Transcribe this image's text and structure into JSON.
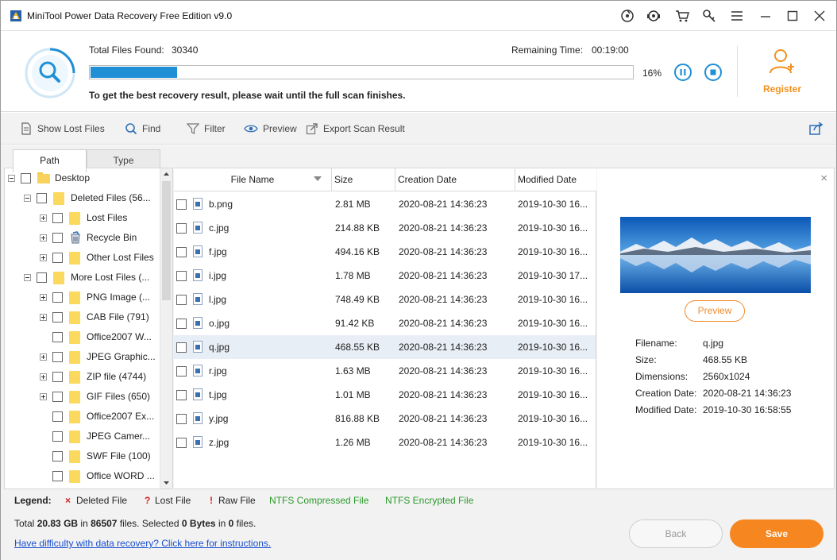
{
  "window": {
    "title": "MiniTool Power Data Recovery Free Edition v9.0"
  },
  "scan": {
    "total_label": "Total Files Found:",
    "total_value": "30340",
    "remaining_label": "Remaining Time:",
    "remaining_value": "00:19:00",
    "progress_text": "16%",
    "progress_fraction": 0.16,
    "hint": "To get the best recovery result, please wait until the full scan finishes.",
    "register_label": "Register"
  },
  "toolbar": {
    "show_lost": "Show Lost Files",
    "find": "Find",
    "filter": "Filter",
    "preview": "Preview",
    "export": "Export Scan Result"
  },
  "tabs": {
    "path": "Path",
    "type": "Type"
  },
  "tree": [
    {
      "label": "Desktop",
      "level": 0,
      "expander": "minus",
      "icon": "folder"
    },
    {
      "label": "Deleted Files (56...",
      "level": 1,
      "expander": "minus",
      "icon": "folder-tall"
    },
    {
      "label": "Lost Files",
      "level": 2,
      "expander": "plus",
      "icon": "folder-tall"
    },
    {
      "label": "Recycle Bin",
      "level": 2,
      "expander": "plus",
      "icon": "recycle-bin"
    },
    {
      "label": "Other Lost Files",
      "level": 2,
      "expander": "plus",
      "icon": "folder-tall"
    },
    {
      "label": "More Lost Files (...",
      "level": 1,
      "expander": "minus",
      "icon": "folder-tall"
    },
    {
      "label": "PNG Image (...",
      "level": 2,
      "expander": "plus",
      "icon": "folder-tall"
    },
    {
      "label": "CAB File (791)",
      "level": 2,
      "expander": "plus",
      "icon": "folder-tall"
    },
    {
      "label": "Office2007 W...",
      "level": 2,
      "expander": "none",
      "icon": "folder-tall"
    },
    {
      "label": "JPEG Graphic...",
      "level": 2,
      "expander": "plus",
      "icon": "folder-tall"
    },
    {
      "label": "ZIP file (4744)",
      "level": 2,
      "expander": "plus",
      "icon": "folder-tall"
    },
    {
      "label": "GIF Files (650)",
      "level": 2,
      "expander": "plus",
      "icon": "folder-tall"
    },
    {
      "label": "Office2007 Ex...",
      "level": 2,
      "expander": "none",
      "icon": "folder-tall"
    },
    {
      "label": "JPEG Camer...",
      "level": 2,
      "expander": "none",
      "icon": "folder-tall"
    },
    {
      "label": "SWF File (100)",
      "level": 2,
      "expander": "none",
      "icon": "folder-tall"
    },
    {
      "label": "Office WORD ...",
      "level": 2,
      "expander": "none",
      "icon": "folder-tall"
    }
  ],
  "table": {
    "columns": [
      "File Name",
      "Size",
      "Creation Date",
      "Modified Date"
    ],
    "rows": [
      {
        "name": "b.png",
        "size": "2.81 MB",
        "created": "2020-08-21 14:36:23",
        "modified": "2019-10-30 16..."
      },
      {
        "name": "c.jpg",
        "size": "214.88 KB",
        "created": "2020-08-21 14:36:23",
        "modified": "2019-10-30 16..."
      },
      {
        "name": "f.jpg",
        "size": "494.16 KB",
        "created": "2020-08-21 14:36:23",
        "modified": "2019-10-30 16..."
      },
      {
        "name": "i.jpg",
        "size": "1.78 MB",
        "created": "2020-08-21 14:36:23",
        "modified": "2019-10-30 17..."
      },
      {
        "name": "l.jpg",
        "size": "748.49 KB",
        "created": "2020-08-21 14:36:23",
        "modified": "2019-10-30 16..."
      },
      {
        "name": "o.jpg",
        "size": "91.42 KB",
        "created": "2020-08-21 14:36:23",
        "modified": "2019-10-30 16..."
      },
      {
        "name": "q.jpg",
        "size": "468.55 KB",
        "created": "2020-08-21 14:36:23",
        "modified": "2019-10-30 16...",
        "selected": true
      },
      {
        "name": "r.jpg",
        "size": "1.63 MB",
        "created": "2020-08-21 14:36:23",
        "modified": "2019-10-30 16..."
      },
      {
        "name": "t.jpg",
        "size": "1.01 MB",
        "created": "2020-08-21 14:36:23",
        "modified": "2019-10-30 16..."
      },
      {
        "name": "y.jpg",
        "size": "816.88 KB",
        "created": "2020-08-21 14:36:23",
        "modified": "2019-10-30 16..."
      },
      {
        "name": "z.jpg",
        "size": "1.26 MB",
        "created": "2020-08-21 14:36:23",
        "modified": "2019-10-30 16..."
      }
    ]
  },
  "preview": {
    "button": "Preview",
    "filename_label": "Filename:",
    "filename": "q.jpg",
    "size_label": "Size:",
    "size": "468.55 KB",
    "dimensions_label": "Dimensions:",
    "dimensions": "2560x1024",
    "created_label": "Creation Date:",
    "created": "2020-08-21 14:36:23",
    "modified_label": "Modified Date:",
    "modified": "2019-10-30 16:58:55"
  },
  "legend": {
    "title": "Legend:",
    "deleted": "Deleted File",
    "lost": "Lost File",
    "raw": "Raw File",
    "compressed": "NTFS Compressed File",
    "encrypted": "NTFS Encrypted File"
  },
  "footer": {
    "total_prefix": "Total",
    "total_size": "20.83 GB",
    "in_text": "in",
    "total_files": "86507",
    "files_text": "files.  Selected",
    "selected_size": "0 Bytes",
    "in_text2": "in",
    "selected_files": "0",
    "files_end": "files.",
    "help_link": "Have difficulty with data recovery? Click here for instructions.",
    "back": "Back",
    "save": "Save"
  },
  "colors": {
    "accent": "#1f8fd6",
    "orange": "#f6861f",
    "compressed": "#2a9a2a",
    "deleted_mark": "#d62020"
  }
}
